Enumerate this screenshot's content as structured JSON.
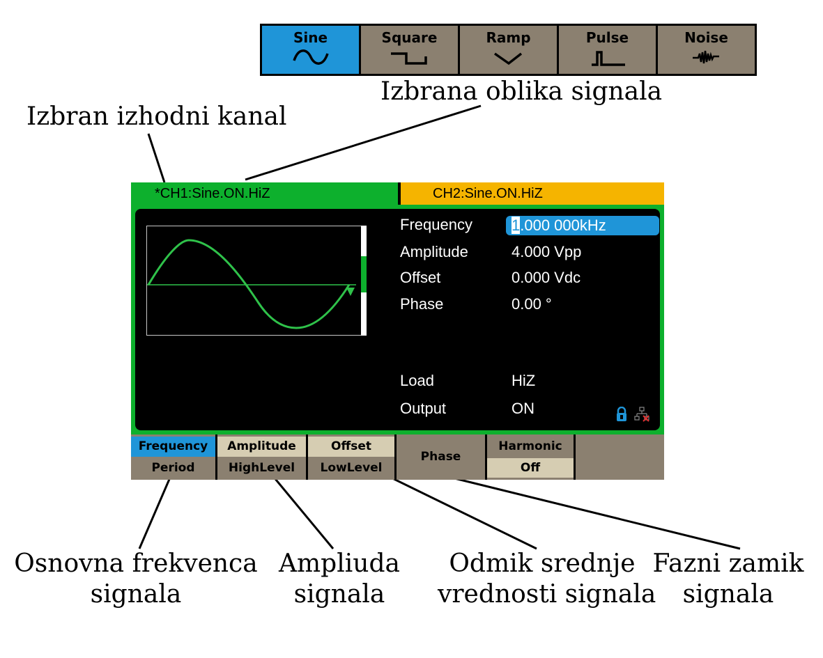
{
  "waveforms": {
    "buttons": [
      {
        "label": "Sine",
        "icon": "sine-wave-icon",
        "active": true
      },
      {
        "label": "Square",
        "icon": "square-wave-icon",
        "active": false
      },
      {
        "label": "Ramp",
        "icon": "ramp-wave-icon",
        "active": false
      },
      {
        "label": "Pulse",
        "icon": "pulse-wave-icon",
        "active": false
      },
      {
        "label": "Noise",
        "icon": "noise-wave-icon",
        "active": false
      }
    ],
    "caption": "Izbrana oblika signala"
  },
  "annotations": {
    "channel": "Izbran izhodni kanal",
    "freq_line1": "Osnovna frekvenca",
    "freq_line2": "signala",
    "amp_line1": "Ampliuda",
    "amp_line2": "signala",
    "offset_line1": "Odmik srednje",
    "offset_line2": "vrednosti signala",
    "phase_line1": "Fazni zamik",
    "phase_line2": "signala"
  },
  "screen": {
    "tab_ch1": "*CH1:Sine.ON.HiZ",
    "tab_ch2": "CH2:Sine.ON.HiZ",
    "params": {
      "frequency_label": "Frequency",
      "frequency_cursor": "1",
      "frequency_rest": ".000 000kHz",
      "amplitude_label": "Amplitude",
      "amplitude_value": "4.000 Vpp",
      "offset_label": "Offset",
      "offset_value": "0.000 Vdc",
      "phase_label": "Phase",
      "phase_value": "0.00 °",
      "load_label": "Load",
      "load_value": "HiZ",
      "output_label": "Output",
      "output_value": "ON"
    },
    "softkeys": {
      "frequency": "Frequency",
      "period": "Period",
      "amplitude": "Amplitude",
      "highlevel": "HighLevel",
      "offset": "Offset",
      "lowlevel": "LowLevel",
      "phase": "Phase",
      "harmonic": "Harmonic",
      "harmonic_state": "Off"
    }
  },
  "colors": {
    "ch1": "#0db02d",
    "ch2": "#f5b400",
    "highlight": "#1f95d8",
    "softkey_bg": "#8b8070",
    "softkey_active_bg": "#d6cdb2"
  }
}
